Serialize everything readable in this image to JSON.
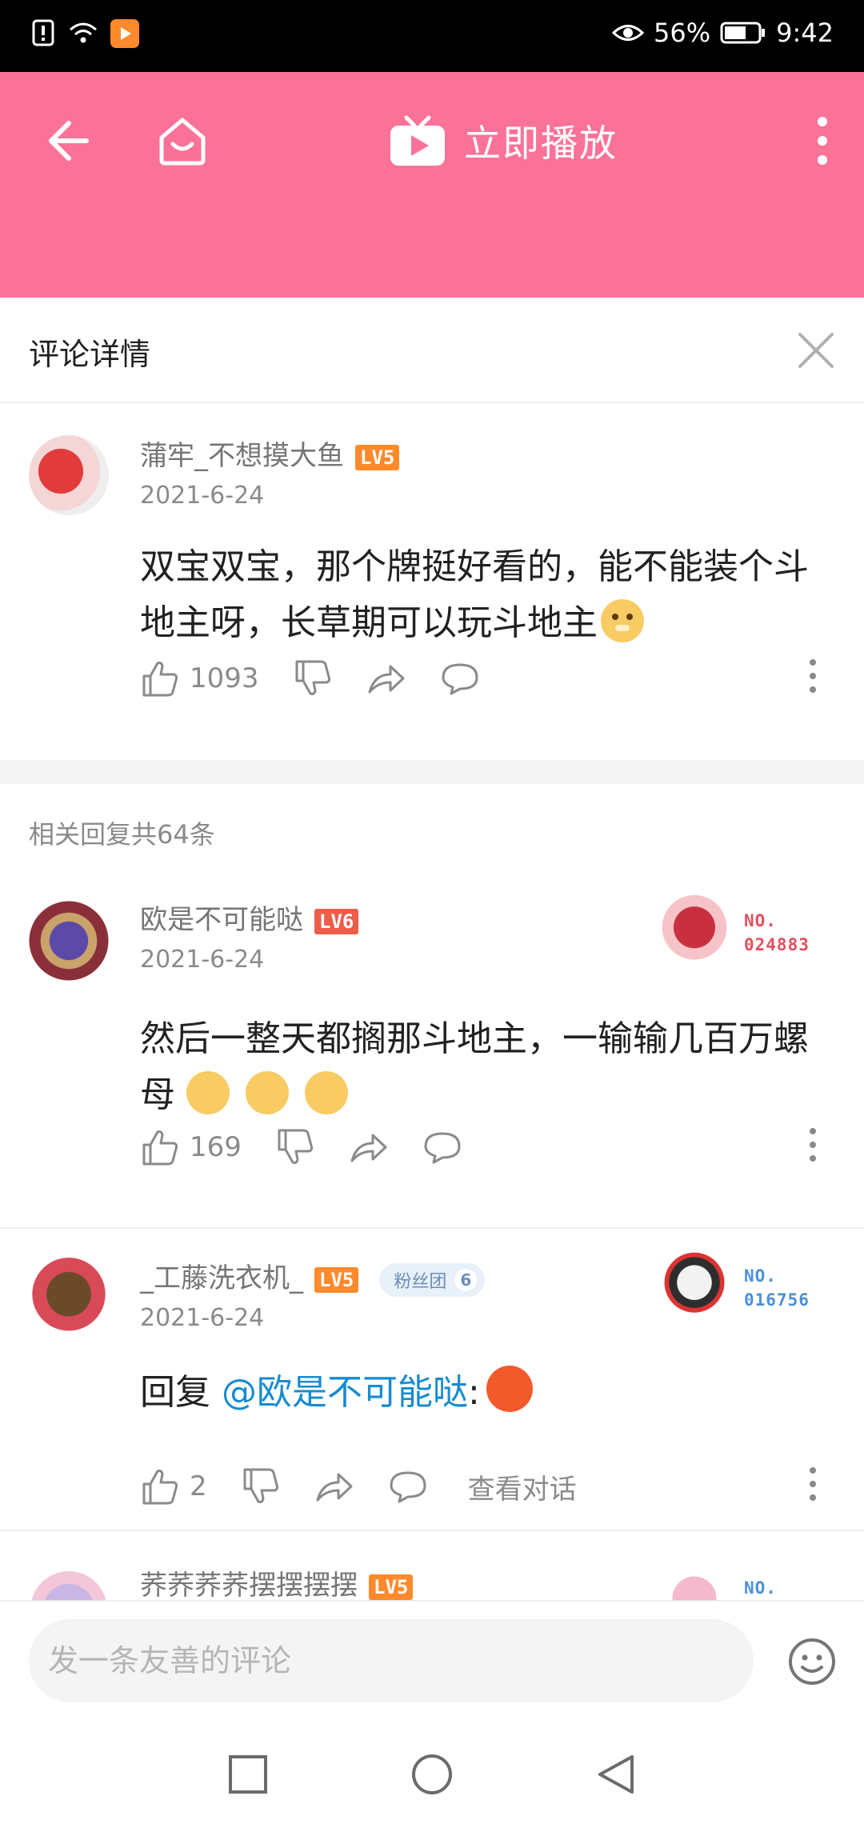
{
  "status_bar": {
    "battery_percent": "56%",
    "time": "9:42"
  },
  "topbar": {
    "play_label": "立即播放",
    "icons": [
      "back-arrow-icon",
      "home-icon",
      "tv-play-icon",
      "more-vertical-icon"
    ],
    "background": "#fb7299"
  },
  "detail": {
    "title": "评论详情"
  },
  "main_comment": {
    "username": "蒲牢_不想摸大鱼",
    "level": "LV5",
    "level_color": "#ff8a2b",
    "date": "2021-6-24",
    "text": "双宝双宝，那个牌挺好看的，能不能装个斗地主呀，长草期可以玩斗地主",
    "likes": "1093"
  },
  "replies_header": "相关回复共64条",
  "replies": [
    {
      "username": "欧是不可能哒",
      "level": "LV6",
      "level_color": "#ee5d4a",
      "date": "2021-6-24",
      "text": "然后一整天都搁那斗地主，一输输几百万螺母",
      "likes": "169",
      "badge_no_label": "NO.",
      "badge_no_value": "024883",
      "badge_color": "#e2505f"
    },
    {
      "username": "_工藤洗衣机_",
      "level": "LV5",
      "level_color": "#ff8a2b",
      "fan_badge_label": "粉丝团",
      "fan_badge_level": "6",
      "date": "2021-6-24",
      "reply_prefix": "回复",
      "mention": "@欧是不可能哒",
      "suffix": ":",
      "likes": "2",
      "view_dialog": "查看对话",
      "badge_no_label": "NO.",
      "badge_no_value": "016756",
      "badge_color": "#4a90d9"
    },
    {
      "username": "荞荞荞荞摆摆摆摆",
      "level": "LV5",
      "level_color": "#ff8a2b",
      "badge_no_label": "NO.",
      "badge_color": "#4a90d9"
    }
  ],
  "input": {
    "placeholder": "发一条友善的评论"
  }
}
